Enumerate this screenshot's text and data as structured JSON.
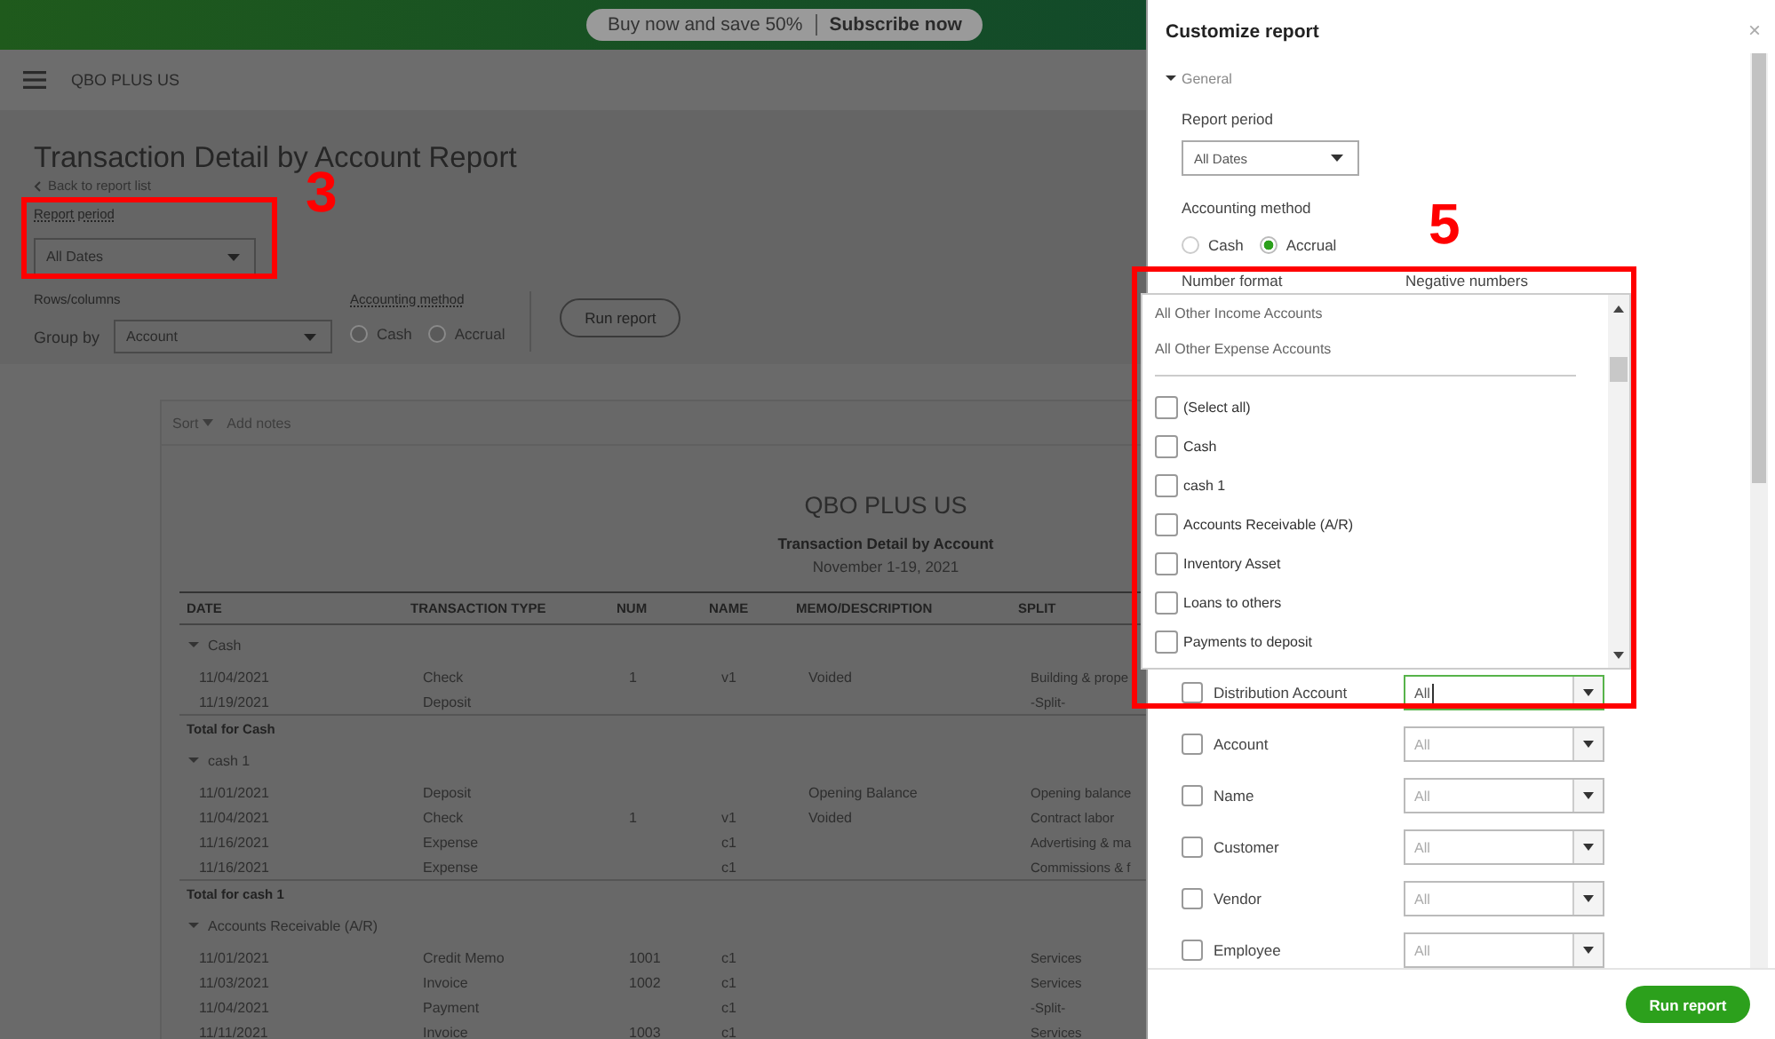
{
  "banner": {
    "offer": "Buy now and save 50%",
    "link": "Subscribe now"
  },
  "header": {
    "company": "QBO PLUS US"
  },
  "page": {
    "title": "Transaction Detail by Account Report",
    "back_link": "Back to report list",
    "report_period": {
      "label": "Report period",
      "value": "All Dates"
    },
    "rows_columns": {
      "label": "Rows/columns",
      "group_by_label": "Group by",
      "group_by_value": "Account"
    },
    "accounting_method": {
      "label": "Accounting method",
      "options": [
        {
          "label": "Cash",
          "selected": false
        },
        {
          "label": "Accrual",
          "selected": false
        }
      ]
    },
    "run_button": "Run report"
  },
  "report": {
    "toolbar": {
      "sort": "Sort",
      "notes": "Add notes"
    },
    "company": "QBO PLUS US",
    "title": "Transaction Detail by Account",
    "period": "November 1-19, 2021",
    "columns": [
      "DATE",
      "TRANSACTION TYPE",
      "NUM",
      "NAME",
      "MEMO/DESCRIPTION",
      "SPLIT"
    ],
    "sections": [
      {
        "name": "Cash",
        "expanded": true,
        "rows": [
          {
            "date": "11/04/2021",
            "type": "Check",
            "num": "1",
            "name": "v1",
            "memo": "Voided",
            "split": "Building & prope"
          },
          {
            "date": "11/19/2021",
            "type": "Deposit",
            "split": "-Split-"
          }
        ],
        "total": "Total for Cash"
      },
      {
        "name": "cash 1",
        "expanded": true,
        "rows": [
          {
            "date": "11/01/2021",
            "type": "Deposit",
            "memo": "Opening Balance",
            "split": "Opening balance"
          },
          {
            "date": "11/04/2021",
            "type": "Check",
            "num": "1",
            "name": "v1",
            "memo": "Voided",
            "split": "Contract labor"
          },
          {
            "date": "11/16/2021",
            "type": "Expense",
            "name": "c1",
            "split": "Advertising & ma"
          },
          {
            "date": "11/16/2021",
            "type": "Expense",
            "name": "c1",
            "split": "Commissions & f"
          }
        ],
        "total": "Total for cash 1"
      },
      {
        "name": "Accounts Receivable (A/R)",
        "expanded": true,
        "rows": [
          {
            "date": "11/01/2021",
            "type": "Credit Memo",
            "num": "1001",
            "name": "c1",
            "split": "Services"
          },
          {
            "date": "11/03/2021",
            "type": "Invoice",
            "num": "1002",
            "name": "c1",
            "split": "Services"
          },
          {
            "date": "11/04/2021",
            "type": "Payment",
            "name": "c1",
            "split": "-Split-"
          },
          {
            "date": "11/11/2021",
            "type": "Invoice",
            "num": "1003",
            "name": "c1",
            "split": "Services"
          }
        ]
      }
    ]
  },
  "panel": {
    "title": "Customize report",
    "close": "×",
    "section": "General",
    "section_expanded": true,
    "report_period": {
      "label": "Report period",
      "value": "All Dates"
    },
    "accounting_method": {
      "label": "Accounting method",
      "options": [
        {
          "label": "Cash",
          "selected": false
        },
        {
          "label": "Accrual",
          "selected": true
        }
      ]
    },
    "number_format_label": "Number format",
    "negative_numbers_label": "Negative numbers",
    "dropdown": {
      "groups": [
        "All Other Income Accounts",
        "All Other Expense Accounts"
      ],
      "options": [
        {
          "label": "(Select all)",
          "checked": false
        },
        {
          "label": "Cash",
          "checked": false
        },
        {
          "label": "cash 1",
          "checked": false
        },
        {
          "label": "Accounts Receivable (A/R)",
          "checked": false
        },
        {
          "label": "Inventory Asset",
          "checked": false
        },
        {
          "label": "Loans to others",
          "checked": false
        },
        {
          "label": "Payments to deposit",
          "checked": false
        }
      ]
    },
    "filters": [
      {
        "label": "Distribution Account",
        "value": "All",
        "checked": false,
        "focused": true
      },
      {
        "label": "Account",
        "value": "All",
        "checked": false,
        "focused": false
      },
      {
        "label": "Name",
        "value": "All",
        "checked": false,
        "focused": false
      },
      {
        "label": "Customer",
        "value": "All",
        "checked": false,
        "focused": false
      },
      {
        "label": "Vendor",
        "value": "All",
        "checked": false,
        "focused": false
      },
      {
        "label": "Employee",
        "value": "All",
        "checked": false,
        "focused": false
      }
    ],
    "run_button": "Run report"
  },
  "annotations": [
    {
      "label": "3"
    },
    {
      "label": "5"
    }
  ]
}
